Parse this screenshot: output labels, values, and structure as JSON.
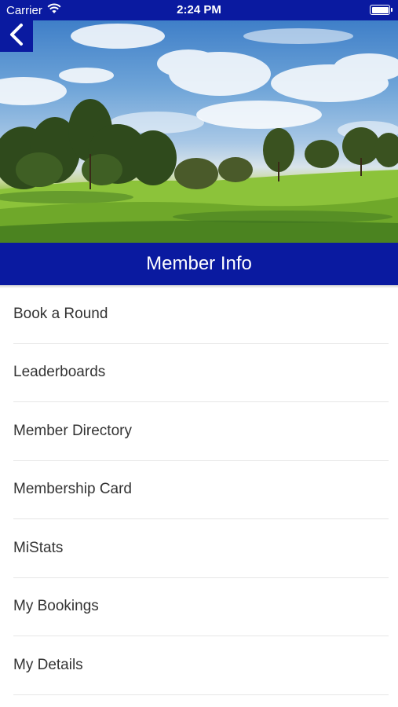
{
  "status_bar": {
    "carrier": "Carrier",
    "time": "2:24 PM",
    "wifi_icon": "wifi-icon",
    "battery_icon": "battery-icon"
  },
  "header": {
    "back_icon": "chevron-left-icon",
    "title": "Member Info",
    "accent_color": "#0a1aa0"
  },
  "menu": {
    "items": [
      {
        "label": "Book a Round"
      },
      {
        "label": "Leaderboards"
      },
      {
        "label": "Member Directory"
      },
      {
        "label": "Membership Card"
      },
      {
        "label": "MiStats"
      },
      {
        "label": "My Bookings"
      },
      {
        "label": "My Details"
      }
    ]
  }
}
